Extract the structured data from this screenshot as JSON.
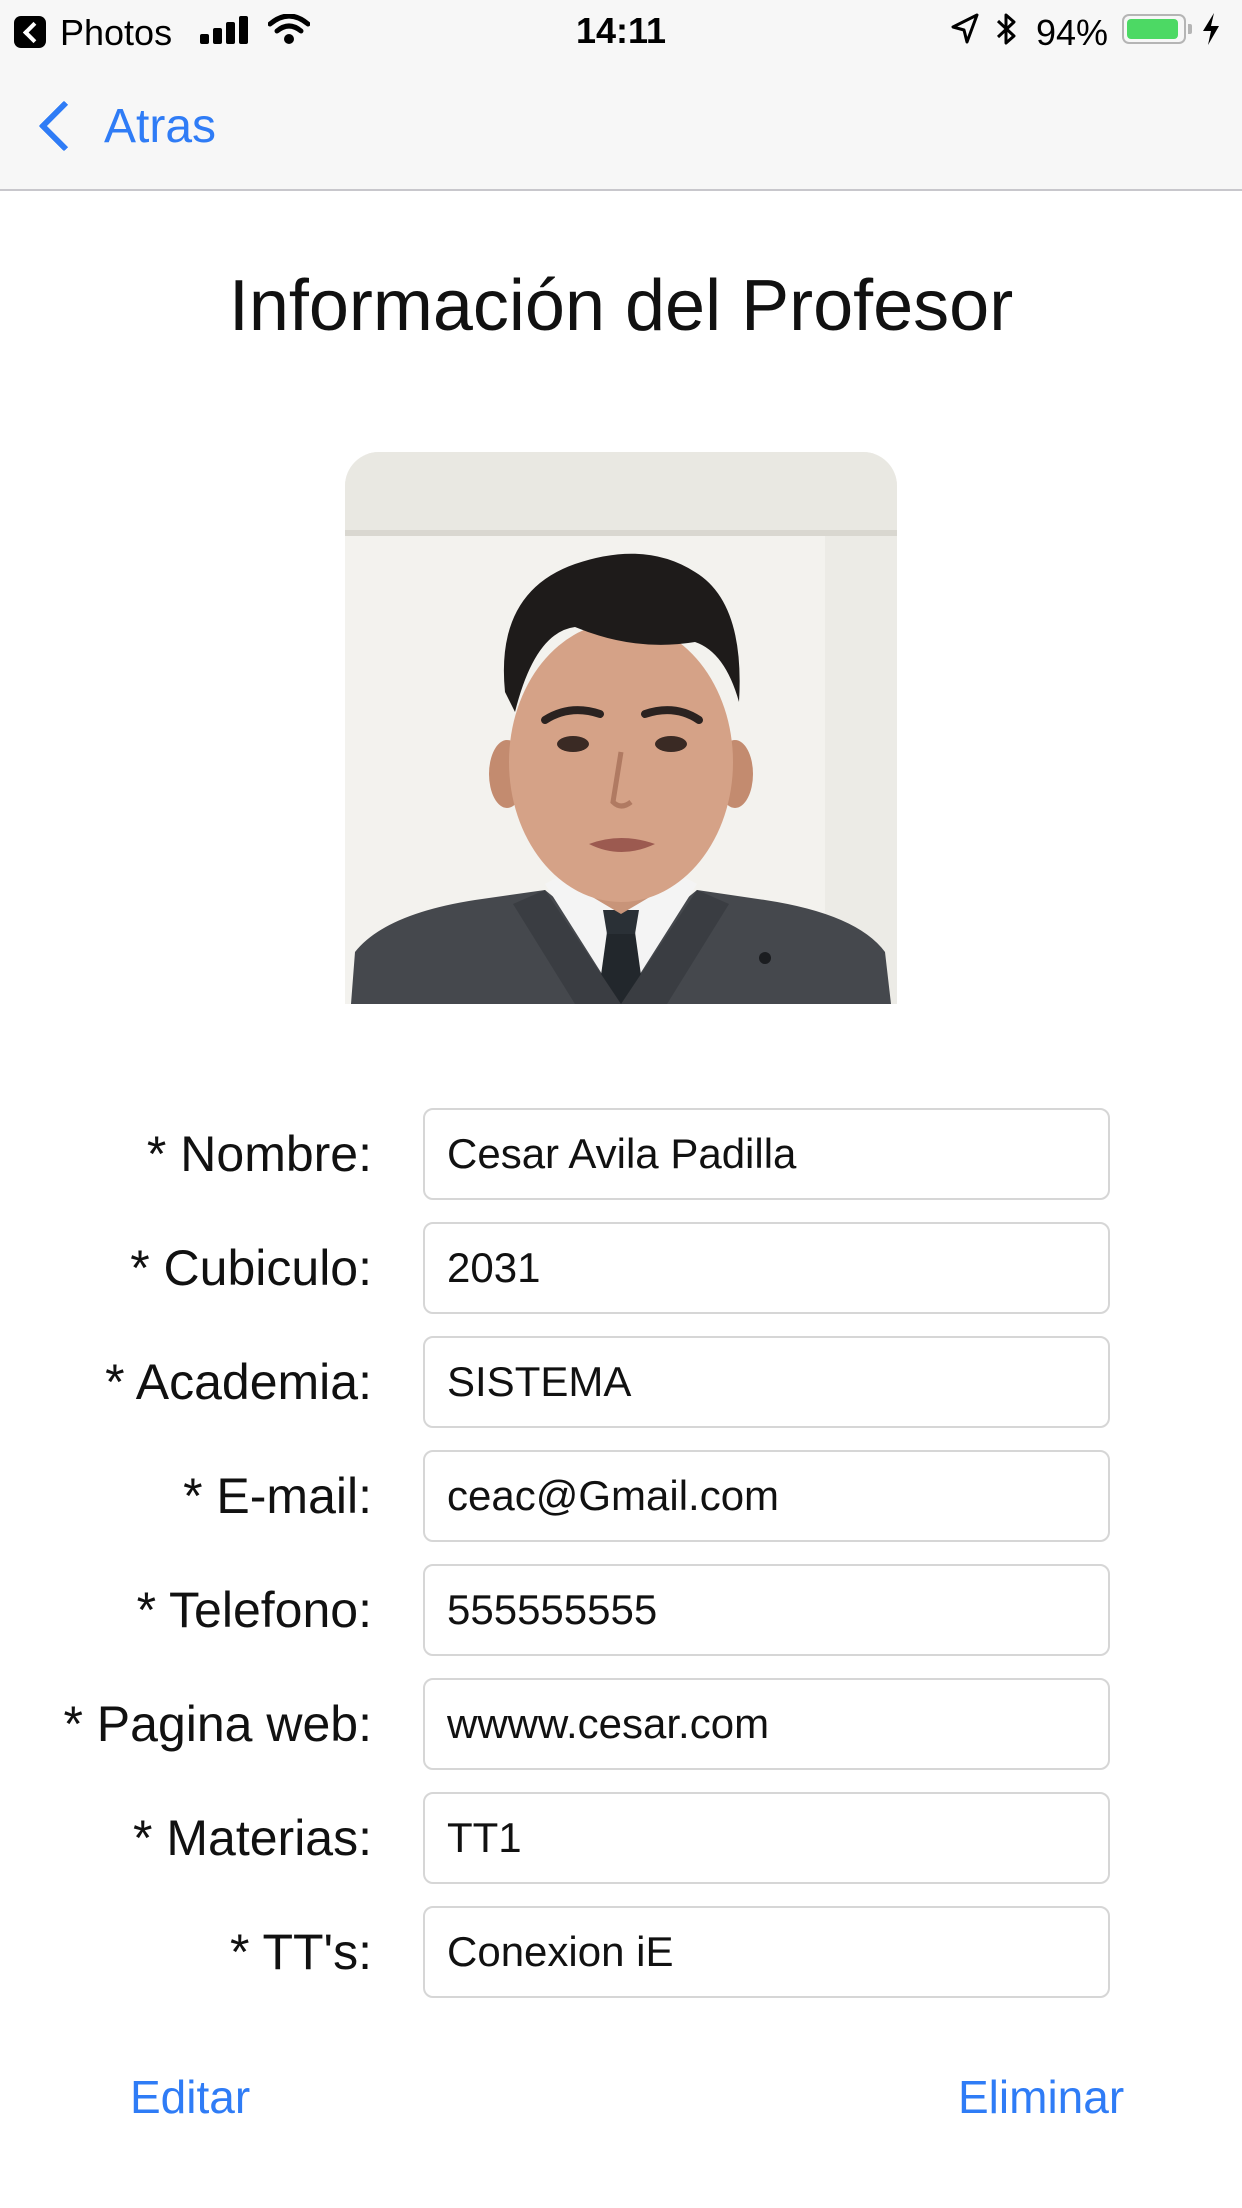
{
  "status_bar": {
    "back_app": "Photos",
    "time": "14:11",
    "battery_percent": "94%",
    "battery_level": 0.94
  },
  "nav": {
    "back_label": "Atras"
  },
  "page": {
    "title": "Información del Profesor"
  },
  "form": {
    "fields": [
      {
        "label": "* Nombre:",
        "value": "Cesar Avila Padilla"
      },
      {
        "label": "* Cubiculo:",
        "value": "2031"
      },
      {
        "label": "* Academia:",
        "value": "SISTEMA"
      },
      {
        "label": "* E-mail:",
        "value": "ceac@Gmail.com"
      },
      {
        "label": "* Telefono:",
        "value": "555555555"
      },
      {
        "label": "* Pagina web:",
        "value": "wwww.cesar.com"
      },
      {
        "label": "* Materias:",
        "value": "TT1"
      },
      {
        "label": "* TT's:",
        "value": "Conexion iE"
      }
    ]
  },
  "actions": {
    "edit_label": "Editar",
    "delete_label": "Eliminar"
  },
  "colors": {
    "accent": "#2f7cf6",
    "battery": "#4cd964"
  }
}
